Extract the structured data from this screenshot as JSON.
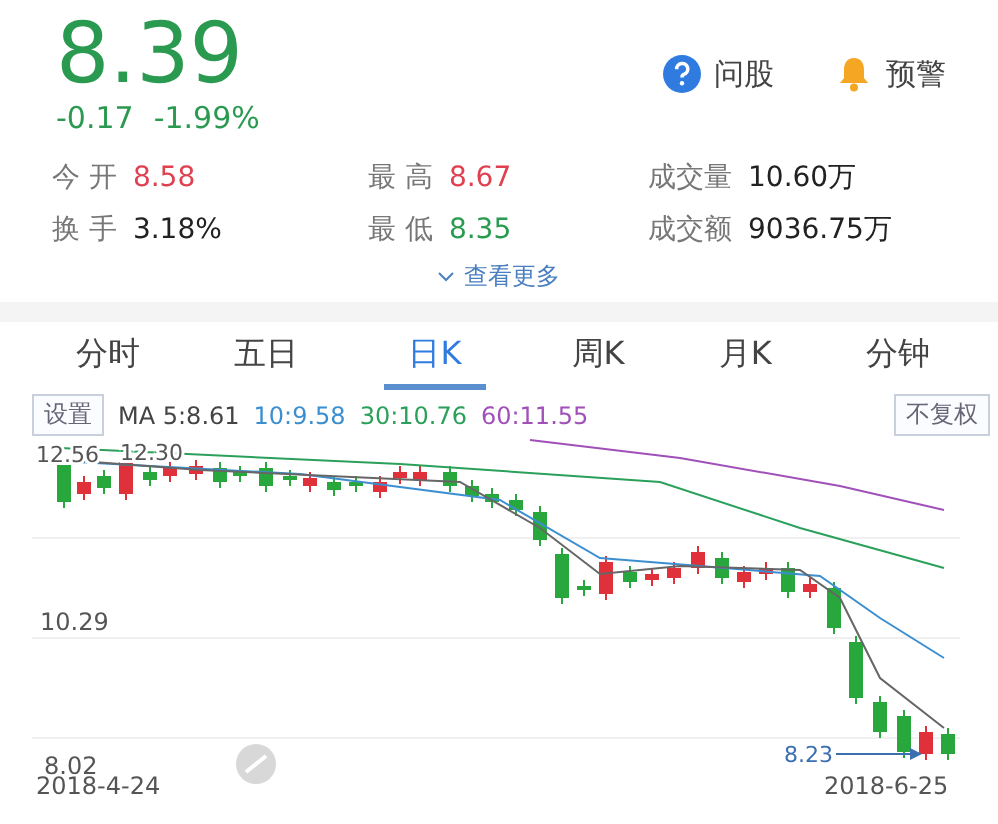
{
  "quote": {
    "price": "8.39",
    "change": "-0.17",
    "change_pct": "-1.99%"
  },
  "actions": [
    {
      "kind": "question",
      "label": "问股"
    },
    {
      "kind": "bell",
      "label": "预警"
    }
  ],
  "stats": [
    {
      "label": "今 开",
      "value": "8.58",
      "color": "#e04050"
    },
    {
      "label": "最 高",
      "value": "8.67",
      "color": "#e04050"
    },
    {
      "label": "成交量",
      "value": "10.60万",
      "color": "#222222"
    },
    {
      "label": "换 手",
      "value": "3.18%",
      "color": "#222222"
    },
    {
      "label": "最 低",
      "value": "8.35",
      "color": "#2a9a50"
    },
    {
      "label": "成交额",
      "value": "9036.75万",
      "color": "#222222"
    }
  ],
  "more": {
    "label": "查看更多"
  },
  "tabs": [
    {
      "label": "分时",
      "selected": false
    },
    {
      "label": "五日",
      "selected": false
    },
    {
      "label": "日K",
      "selected": true
    },
    {
      "label": "周K",
      "selected": false
    },
    {
      "label": "月K",
      "selected": false
    },
    {
      "label": "分钟",
      "selected": false
    }
  ],
  "settings_button": "设置",
  "ma": [
    {
      "label": "MA 5:8.61",
      "color": "#444444"
    },
    {
      "label": "10:9.58",
      "color": "#3b8fd0"
    },
    {
      "label": "30:10.76",
      "color": "#2aa05a"
    },
    {
      "label": "60:11.55",
      "color": "#a050b8"
    }
  ],
  "adjust_button": "不复权",
  "chart": {
    "high_label": "12.56",
    "high_mark": "12.30",
    "mid_label": "10.29",
    "low_label": "8.02",
    "min_mark": "8.23",
    "start_date": "2018-4-24",
    "end_date": "2018-6-25"
  }
}
